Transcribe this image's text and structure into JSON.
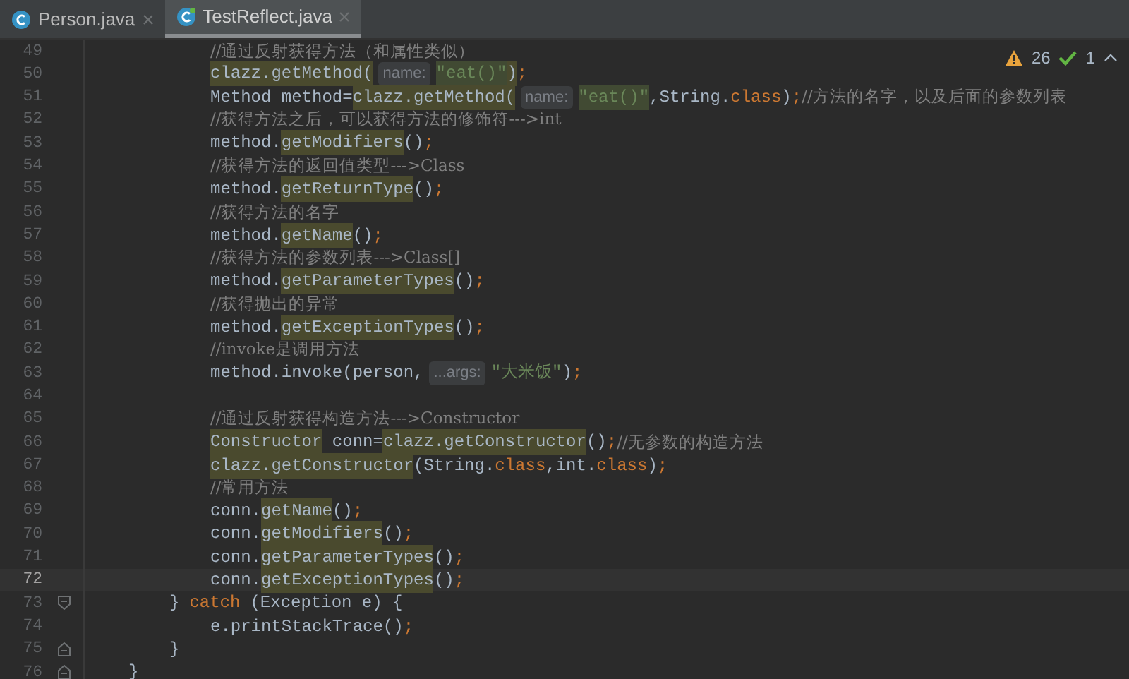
{
  "tabs": [
    {
      "label": "Person.java",
      "selected": false
    },
    {
      "label": "TestReflect.java",
      "selected": true
    }
  ],
  "inspections": {
    "warnings": "26",
    "weak_warnings": "1"
  },
  "lines": [
    {
      "number": "49",
      "current": false,
      "kind": "statement",
      "segments": [
        {
          "kind": "comment",
          "text": "//通过反射获得方法（和属性类似）"
        }
      ]
    },
    {
      "number": "50",
      "current": false,
      "kind": "statement",
      "segments": [
        {
          "kind": "warn",
          "text": "clazz.getMethod("
        },
        {
          "kind": "hint",
          "text": "name:"
        },
        {
          "kind": "warn-string",
          "text": "\"eat()\""
        },
        {
          "kind": "warn",
          "text": ")"
        },
        {
          "kind": "keyword",
          "text": ";"
        }
      ]
    },
    {
      "number": "51",
      "current": false,
      "kind": "statement",
      "segments": [
        {
          "kind": "code",
          "text": "Method method="
        },
        {
          "kind": "warn",
          "text": "clazz.getMethod("
        },
        {
          "kind": "hint",
          "text": "name:"
        },
        {
          "kind": "warn-string",
          "text": "\"eat()\""
        },
        {
          "kind": "code",
          "text": ",String."
        },
        {
          "kind": "keyword",
          "text": "class"
        },
        {
          "kind": "code",
          "text": ")"
        },
        {
          "kind": "keyword",
          "text": ";"
        },
        {
          "kind": "comment",
          "text": "//方法的名字，以及后面的参数列表"
        }
      ]
    },
    {
      "number": "52",
      "current": false,
      "kind": "statement",
      "segments": [
        {
          "kind": "comment",
          "text": "//获得方法之后，可以获得方法的修饰符--->int"
        }
      ]
    },
    {
      "number": "53",
      "current": false,
      "kind": "statement",
      "segments": [
        {
          "kind": "code",
          "text": "method."
        },
        {
          "kind": "warn",
          "text": "getModifiers"
        },
        {
          "kind": "code",
          "text": "()"
        },
        {
          "kind": "keyword",
          "text": ";"
        }
      ]
    },
    {
      "number": "54",
      "current": false,
      "kind": "statement",
      "segments": [
        {
          "kind": "comment",
          "text": "//获得方法的返回值类型--->Class"
        }
      ]
    },
    {
      "number": "55",
      "current": false,
      "kind": "statement",
      "segments": [
        {
          "kind": "code",
          "text": "method."
        },
        {
          "kind": "warn",
          "text": "getReturnType"
        },
        {
          "kind": "code",
          "text": "()"
        },
        {
          "kind": "keyword",
          "text": ";"
        }
      ]
    },
    {
      "number": "56",
      "current": false,
      "kind": "statement",
      "segments": [
        {
          "kind": "comment",
          "text": "//获得方法的名字"
        }
      ]
    },
    {
      "number": "57",
      "current": false,
      "kind": "statement",
      "segments": [
        {
          "kind": "code",
          "text": "method."
        },
        {
          "kind": "warn",
          "text": "getName"
        },
        {
          "kind": "code",
          "text": "()"
        },
        {
          "kind": "keyword",
          "text": ";"
        }
      ]
    },
    {
      "number": "58",
      "current": false,
      "kind": "statement",
      "segments": [
        {
          "kind": "comment",
          "text": "//获得方法的参数列表--->Class[]"
        }
      ]
    },
    {
      "number": "59",
      "current": false,
      "kind": "statement",
      "segments": [
        {
          "kind": "code",
          "text": "method."
        },
        {
          "kind": "warn",
          "text": "getParameterTypes"
        },
        {
          "kind": "code",
          "text": "()"
        },
        {
          "kind": "keyword",
          "text": ";"
        }
      ]
    },
    {
      "number": "60",
      "current": false,
      "kind": "statement",
      "segments": [
        {
          "kind": "comment",
          "text": "//获得抛出的异常"
        }
      ]
    },
    {
      "number": "61",
      "current": false,
      "kind": "statement",
      "segments": [
        {
          "kind": "code",
          "text": "method."
        },
        {
          "kind": "warn",
          "text": "getExceptionTypes"
        },
        {
          "kind": "code",
          "text": "()"
        },
        {
          "kind": "keyword",
          "text": ";"
        }
      ]
    },
    {
      "number": "62",
      "current": false,
      "kind": "statement",
      "segments": [
        {
          "kind": "comment",
          "text": "//invoke是调用方法"
        }
      ]
    },
    {
      "number": "63",
      "current": false,
      "kind": "statement",
      "segments": [
        {
          "kind": "code",
          "text": "method.invoke(person,"
        },
        {
          "kind": "hint",
          "text": "...args:"
        },
        {
          "kind": "string",
          "text": "\"大米饭\""
        },
        {
          "kind": "code",
          "text": ")"
        },
        {
          "kind": "keyword",
          "text": ";"
        }
      ]
    },
    {
      "number": "64",
      "current": false,
      "kind": "blank"
    },
    {
      "number": "65",
      "current": false,
      "kind": "statement",
      "segments": [
        {
          "kind": "comment",
          "text": "//通过反射获得构造方法--->Constructor"
        }
      ]
    },
    {
      "number": "66",
      "current": false,
      "kind": "statement",
      "segments": [
        {
          "kind": "warn",
          "text": "Constructor"
        },
        {
          "kind": "code",
          "text": " conn="
        },
        {
          "kind": "warn",
          "text": "clazz.getConstructor"
        },
        {
          "kind": "code",
          "text": "()"
        },
        {
          "kind": "keyword",
          "text": ";"
        },
        {
          "kind": "comment",
          "text": "//无参数的构造方法"
        }
      ]
    },
    {
      "number": "67",
      "current": false,
      "kind": "statement",
      "segments": [
        {
          "kind": "warn",
          "text": "clazz.getConstructor"
        },
        {
          "kind": "code",
          "text": "(String."
        },
        {
          "kind": "keyword",
          "text": "class"
        },
        {
          "kind": "code",
          "text": ",int."
        },
        {
          "kind": "keyword",
          "text": "class"
        },
        {
          "kind": "code",
          "text": ")"
        },
        {
          "kind": "keyword",
          "text": ";"
        }
      ]
    },
    {
      "number": "68",
      "current": false,
      "kind": "statement",
      "segments": [
        {
          "kind": "comment",
          "text": "//常用方法"
        }
      ]
    },
    {
      "number": "69",
      "current": false,
      "kind": "statement",
      "segments": [
        {
          "kind": "code",
          "text": "conn."
        },
        {
          "kind": "warn",
          "text": "getName"
        },
        {
          "kind": "code",
          "text": "()"
        },
        {
          "kind": "keyword",
          "text": ";"
        }
      ]
    },
    {
      "number": "70",
      "current": false,
      "kind": "statement",
      "segments": [
        {
          "kind": "code",
          "text": "conn."
        },
        {
          "kind": "warn",
          "text": "getModifiers"
        },
        {
          "kind": "code",
          "text": "()"
        },
        {
          "kind": "keyword",
          "text": ";"
        }
      ]
    },
    {
      "number": "71",
      "current": false,
      "kind": "statement",
      "segments": [
        {
          "kind": "code",
          "text": "conn."
        },
        {
          "kind": "warn",
          "text": "getParameterTypes"
        },
        {
          "kind": "code",
          "text": "()"
        },
        {
          "kind": "keyword",
          "text": ";"
        }
      ]
    },
    {
      "number": "72",
      "current": true,
      "kind": "statement",
      "segments": [
        {
          "kind": "code",
          "text": "conn."
        },
        {
          "kind": "warn",
          "text": "getExceptionTypes"
        },
        {
          "kind": "code",
          "text": "()"
        },
        {
          "kind": "keyword",
          "text": ";"
        }
      ]
    },
    {
      "number": "73",
      "current": false,
      "kind": "catch",
      "segments": [
        {
          "kind": "code",
          "text": "}"
        },
        {
          "kind": "keyword",
          "text": "catch"
        },
        {
          "kind": "code",
          "text": "(Exception e) {"
        }
      ]
    },
    {
      "number": "74",
      "current": false,
      "kind": "statement",
      "segments": [
        {
          "kind": "code",
          "text": "e.printStackTrace()"
        },
        {
          "kind": "keyword",
          "text": ";"
        }
      ]
    },
    {
      "number": "75",
      "current": false,
      "kind": "block-end",
      "segments": [
        {
          "kind": "code",
          "text": "}"
        }
      ]
    },
    {
      "number": "76",
      "current": false,
      "kind": "method-end",
      "segments": [
        {
          "kind": "code",
          "text": "}"
        }
      ]
    }
  ]
}
